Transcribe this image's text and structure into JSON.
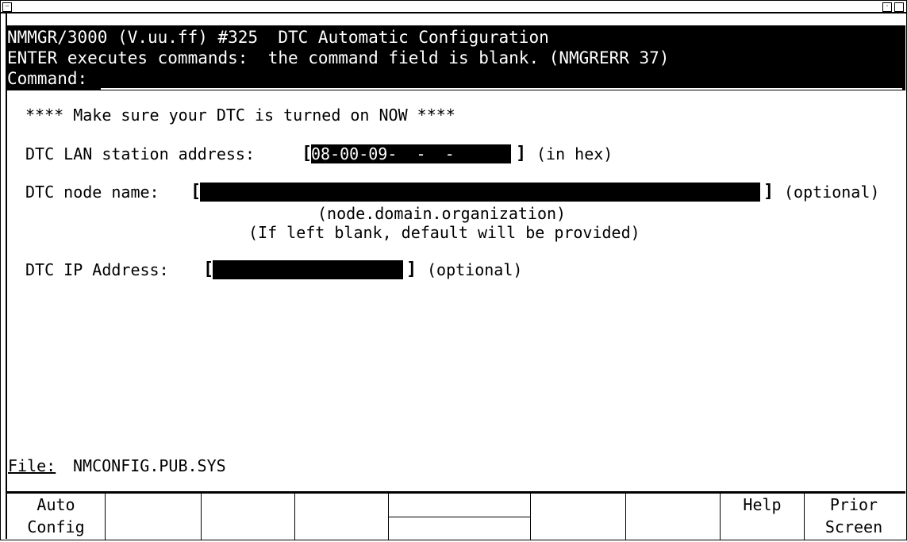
{
  "header": {
    "line1": "NMMGR/3000 (V.uu.ff) #325  DTC Automatic Configuration",
    "line2": "ENTER executes commands:  the command field is blank. (NMGRERR 37)",
    "command_label": "Command:"
  },
  "body": {
    "warning": "**** Make sure your DTC is turned on NOW ****",
    "lan_label": "DTC LAN station address:",
    "lan_value": "08-00-09-  -  -  ",
    "lan_suffix": "(in hex)",
    "node_label": "DTC node name:",
    "node_value": "",
    "node_suffix": "(optional)",
    "node_hint1": "(node.domain.organization)",
    "node_hint2": "(If left blank, default will be provided)",
    "ip_label": "DTC IP Address:",
    "ip_value": "",
    "ip_suffix": "(optional)"
  },
  "file": {
    "label": "File:",
    "value": "NMCONFIG.PUB.SYS"
  },
  "softkeys": [
    {
      "line1": "Auto",
      "line2": "Config"
    },
    {
      "line1": "",
      "line2": ""
    },
    {
      "line1": "",
      "line2": ""
    },
    {
      "line1": "",
      "line2": ""
    },
    {
      "line1": "",
      "line2": ""
    },
    {
      "line1": "",
      "line2": ""
    },
    {
      "line1": "",
      "line2": ""
    },
    {
      "line1": "Help",
      "line2": ""
    },
    {
      "line1": "Prior",
      "line2": "Screen"
    }
  ]
}
